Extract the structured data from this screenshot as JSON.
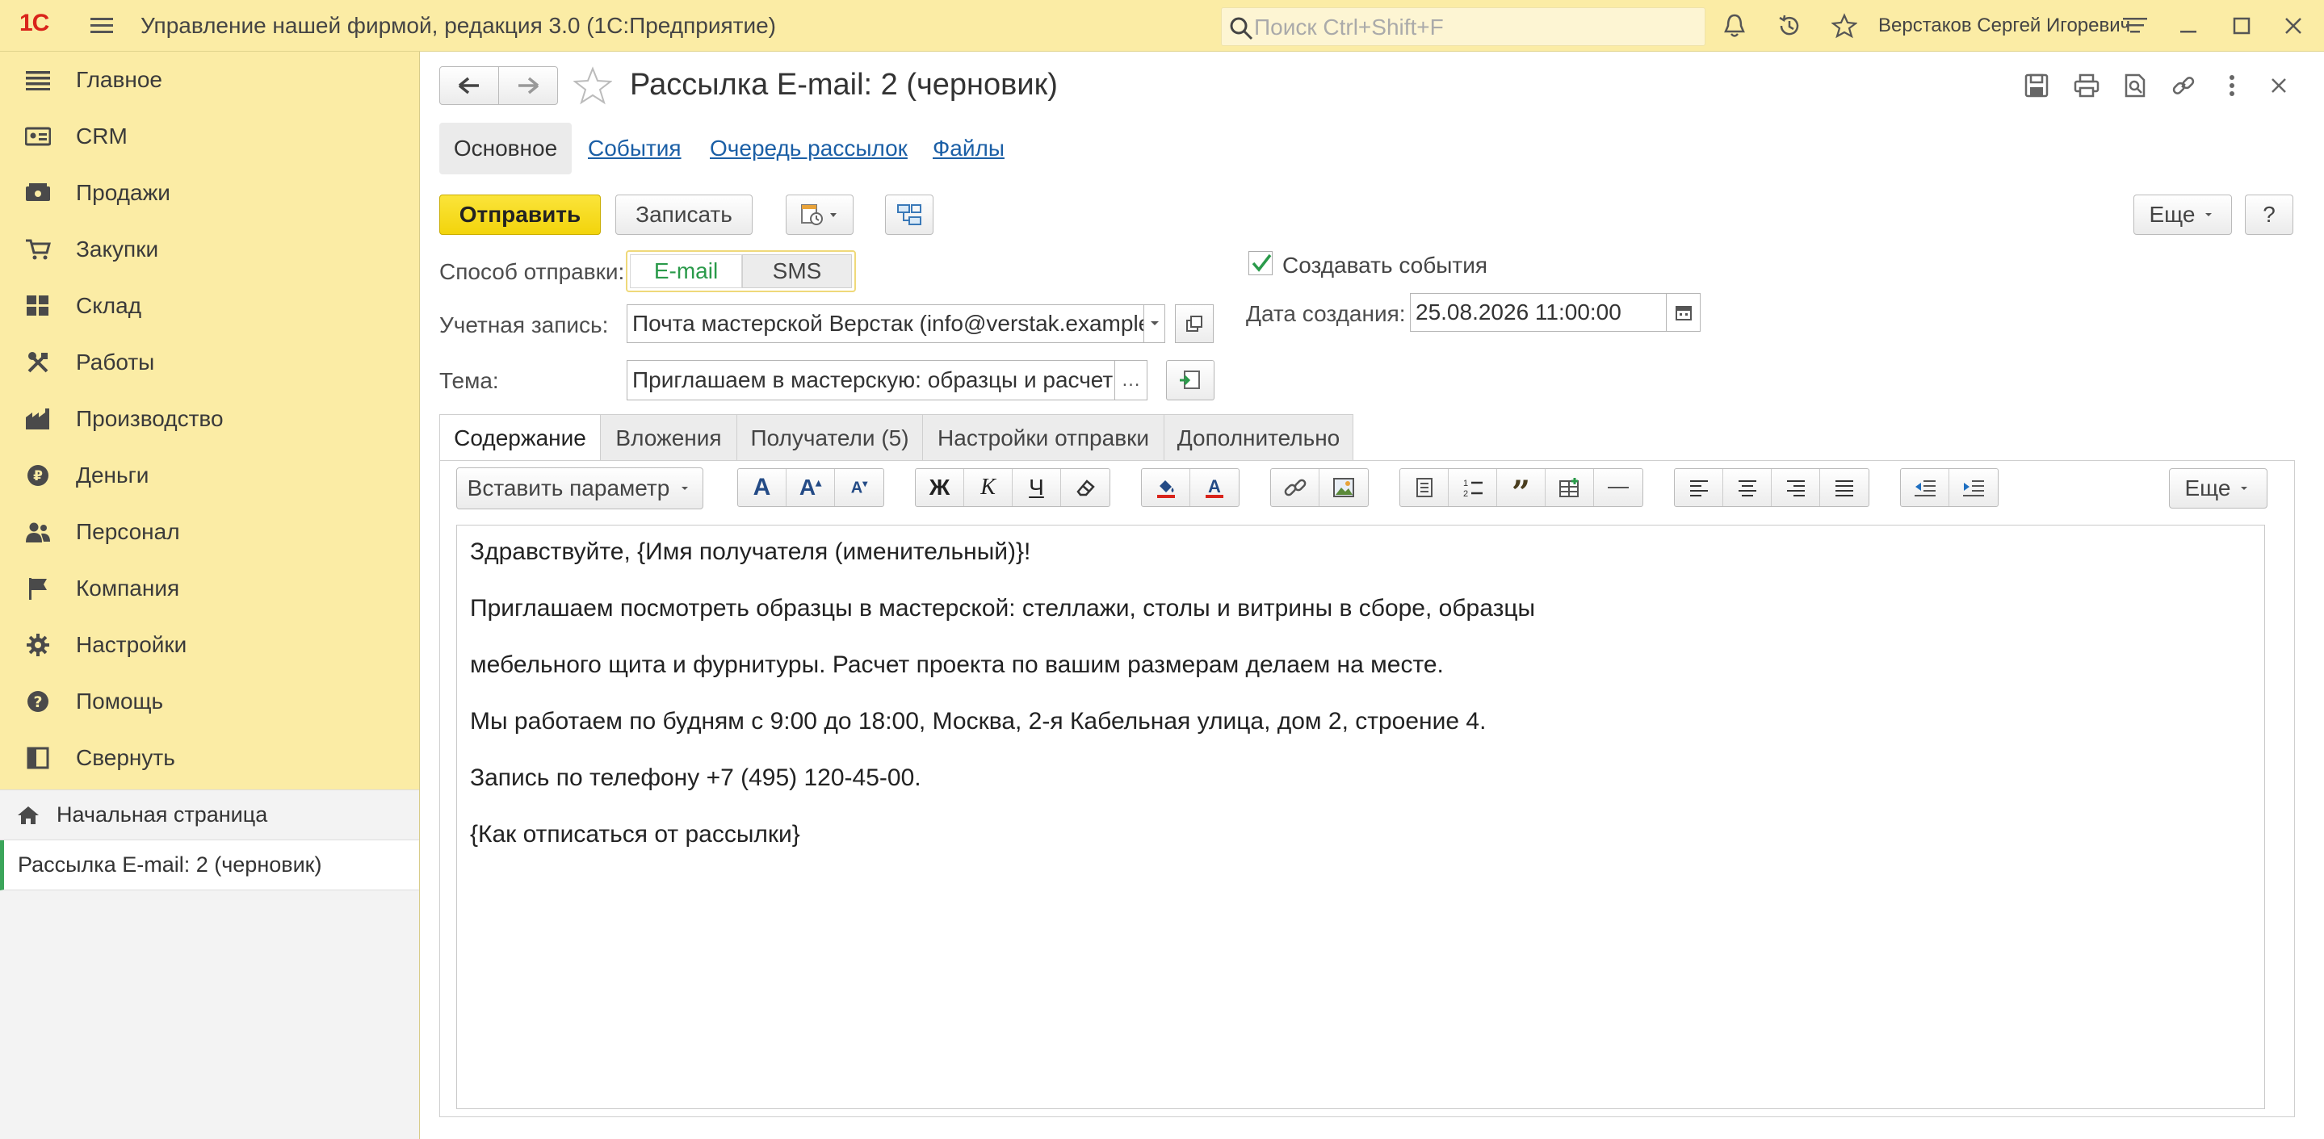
{
  "titlebar": {
    "logo": "1С",
    "app_title": "Управление нашей фирмой, редакция 3.0  (1С:Предприятие)",
    "search_placeholder": "Поиск Ctrl+Shift+F",
    "user_name": "Верстаков Сергей Игоревич"
  },
  "sidebar": {
    "items": [
      {
        "label": "Главное",
        "icon": "menu-lines-icon"
      },
      {
        "label": "CRM",
        "icon": "crm-icon"
      },
      {
        "label": "Продажи",
        "icon": "sales-icon"
      },
      {
        "label": "Закупки",
        "icon": "cart-icon"
      },
      {
        "label": "Склад",
        "icon": "warehouse-icon"
      },
      {
        "label": "Работы",
        "icon": "tools-icon"
      },
      {
        "label": "Производство",
        "icon": "factory-icon"
      },
      {
        "label": "Деньги",
        "icon": "money-icon"
      },
      {
        "label": "Персонал",
        "icon": "people-icon"
      },
      {
        "label": "Компания",
        "icon": "flag-icon"
      },
      {
        "label": "Настройки",
        "icon": "gear-icon"
      },
      {
        "label": "Помощь",
        "icon": "help-icon"
      },
      {
        "label": "Свернуть",
        "icon": "collapse-icon"
      }
    ],
    "home_page": "Начальная страница",
    "open_window": "Рассылка E-mail: 2  (черновик)"
  },
  "doc": {
    "title": "Рассылка E-mail: 2  (черновик)",
    "nav_tabs": [
      "Основное",
      "События",
      "Очередь рассылок",
      "Файлы"
    ],
    "send_button": "Отправить",
    "save_button": "Записать",
    "more_button": "Еще",
    "help_button": "?",
    "send_method_label": "Способ отправки:",
    "send_method_options": [
      "E-mail",
      "SMS"
    ],
    "send_method_selected": "E-mail",
    "account_label": "Учетная запись:",
    "account_value": "Почта мастерской Верстак (info@verstak.example)",
    "subject_label": "Тема:",
    "subject_value": "Приглашаем в мастерскую: образцы и расчет г",
    "create_events_label": "Создавать события",
    "create_events_checked": true,
    "created_label": "Дата создания:",
    "created_value": "25.08.2026 11:00:00"
  },
  "content_tabs": [
    "Содержание",
    "Вложения",
    "Получатели (5)",
    "Настройки отправки",
    "Дополнительно"
  ],
  "editor": {
    "insert_param_button": "Вставить параметр",
    "more_button": "Еще",
    "lines": [
      "Здравствуйте, {Имя получателя (именительный)}!",
      "Приглашаем посмотреть образцы в мастерской: стеллажи, столы и витрины в сборе, образцы",
      "мебельного щита и фурнитуры. Расчет проекта по вашим размерам делаем на месте.",
      "Мы работаем по будням с 9:00 до 18:00, Москва, 2-я Кабельная улица, дом 2, строение 4.",
      "Запись по телефону +7 (495) 120-45-00.",
      "{Как отписаться от рассылки}"
    ]
  },
  "colors": {
    "titlebar_bg": "#fbeca5",
    "primary_button": "#f5d80f",
    "link": "#1b5fa6",
    "accent_green": "#2a9a4a"
  }
}
